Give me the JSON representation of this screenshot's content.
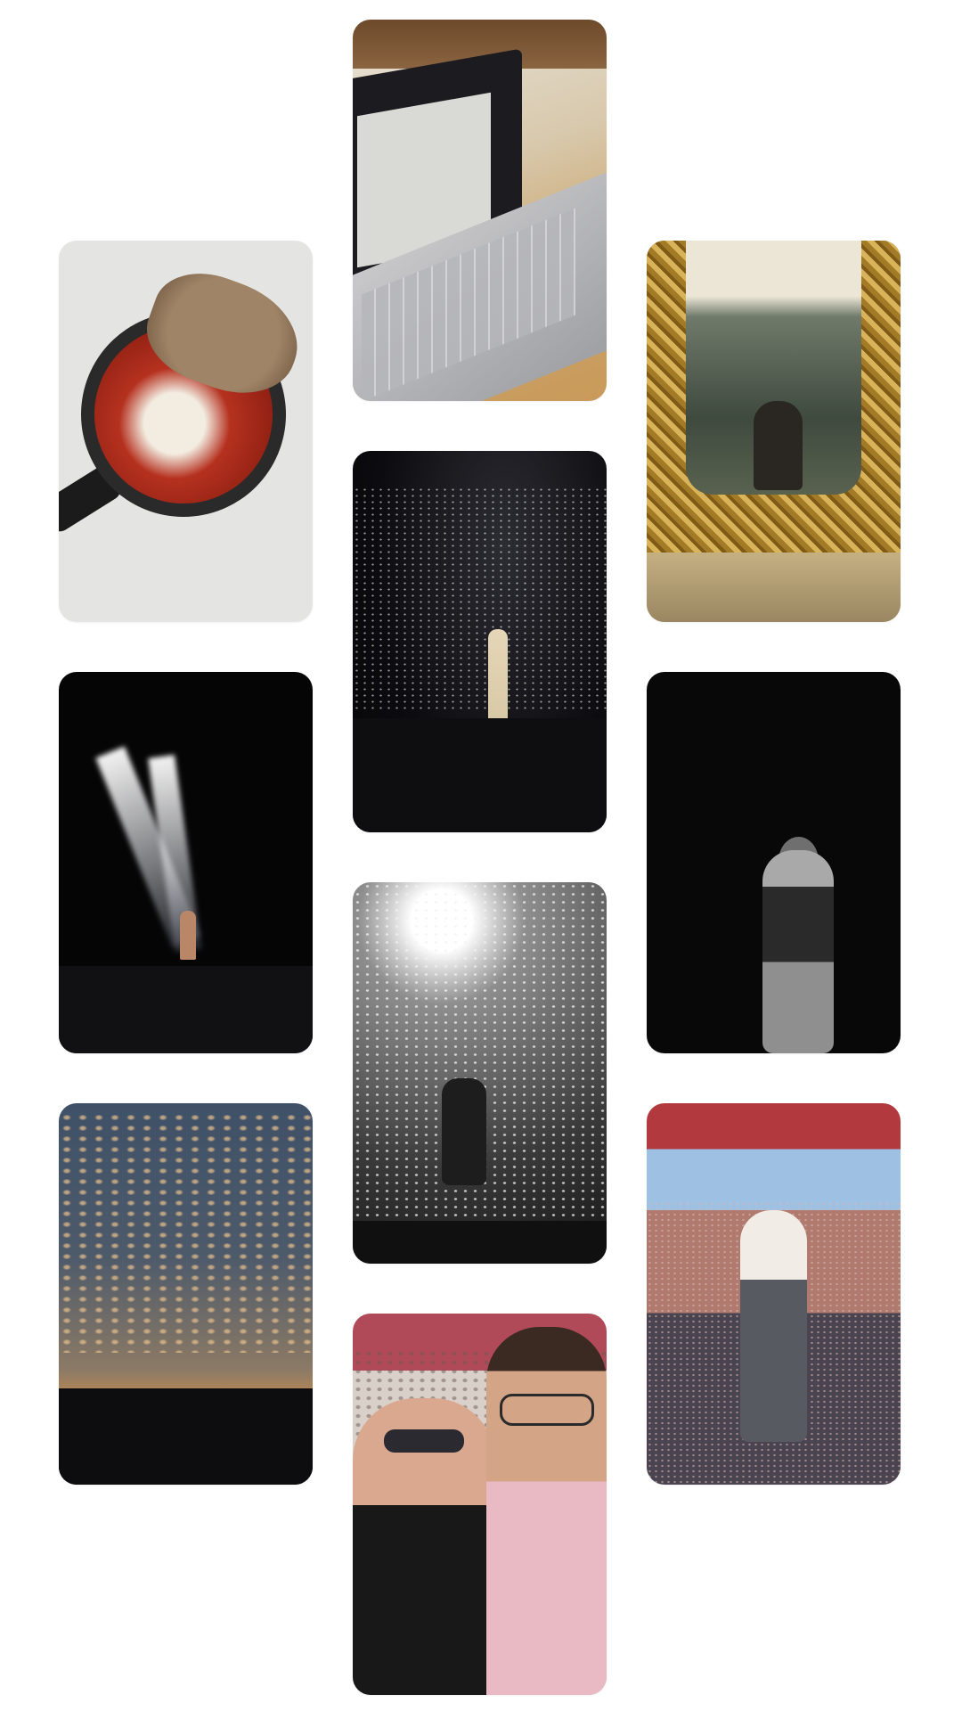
{
  "gallery": {
    "photos": [
      {
        "id": "laptop",
        "subject": "laptop-on-desk"
      },
      {
        "id": "pan",
        "subject": "bread-in-pan"
      },
      {
        "id": "mirror",
        "subject": "gold-mirror"
      },
      {
        "id": "concert1",
        "subject": "concert-crowd-lights"
      },
      {
        "id": "spot",
        "subject": "spotlights-stage"
      },
      {
        "id": "confetti",
        "subject": "confetti-performer"
      },
      {
        "id": "singer",
        "subject": "singer-black-white"
      },
      {
        "id": "sky",
        "subject": "sunset-sky"
      },
      {
        "id": "stadium",
        "subject": "stadium-performer"
      },
      {
        "id": "selfie",
        "subject": "concert-selfie"
      }
    ]
  },
  "colors": {
    "background": "#ffffff"
  }
}
